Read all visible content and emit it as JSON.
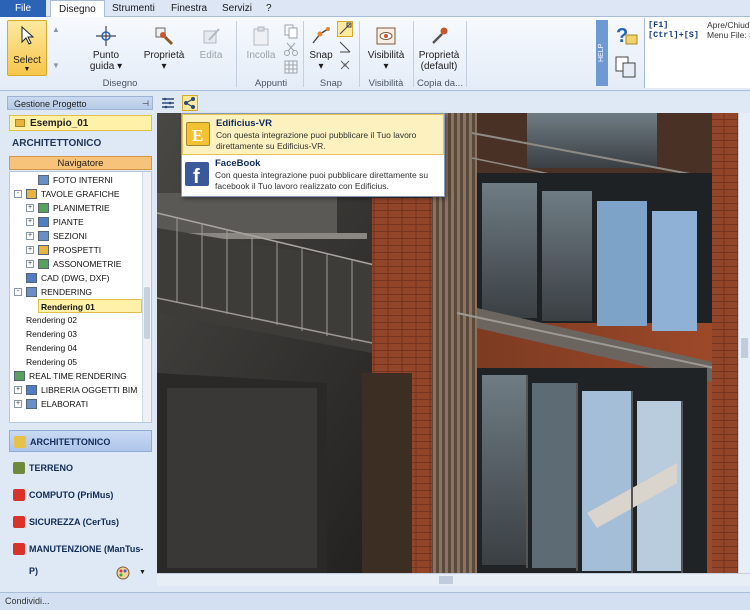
{
  "menu": {
    "file": "File",
    "tabs": [
      "Disegno",
      "Strumenti",
      "Finestra",
      "Servizi",
      "?"
    ]
  },
  "ribbon": {
    "select": "Select",
    "punto_guida": [
      "Punto",
      "guida"
    ],
    "proprieta": "Proprietà",
    "edita": "Edita",
    "incolla": "Incolla",
    "snap": "Snap",
    "visibilita": "Visibilità",
    "proprieta_default": [
      "Proprietà",
      "(default)"
    ],
    "groups": [
      "Disegno",
      "Appunti",
      "Snap",
      "Visibilità",
      "Copia da..."
    ],
    "help_tab": "HELP"
  },
  "shortcuts": [
    {
      "key": "[F1]",
      "desc": "Apre/Chiude"
    },
    {
      "key": "[Ctrl]+[S]",
      "desc": "Menu File: S"
    }
  ],
  "left": {
    "panel_title": "Gestione Progetto",
    "project": "Esempio_01",
    "section": "ARCHITETTONICO",
    "navigator": "Navigatore",
    "tree": [
      {
        "label": "FOTO INTERNI",
        "level": 2
      },
      {
        "label": "TAVOLE GRAFICHE",
        "level": 0,
        "expand": "-"
      },
      {
        "label": "PLANIMETRIE",
        "level": 1,
        "expand": "+"
      },
      {
        "label": "PIANTE",
        "level": 1,
        "expand": "+"
      },
      {
        "label": "SEZIONI",
        "level": 1,
        "expand": "+"
      },
      {
        "label": "PROSPETTI",
        "level": 1,
        "expand": "+"
      },
      {
        "label": "ASSONOMETRIE",
        "level": 1,
        "expand": "+"
      },
      {
        "label": "CAD (DWG, DXF)",
        "level": 1
      },
      {
        "label": "RENDERING",
        "level": 0,
        "expand": "-"
      },
      {
        "label": "Rendering 01",
        "level": 1,
        "selected": true
      },
      {
        "label": "Rendering 02",
        "level": 1
      },
      {
        "label": "Rendering 03",
        "level": 1
      },
      {
        "label": "Rendering 04",
        "level": 1
      },
      {
        "label": "Rendering 05",
        "level": 1
      },
      {
        "label": "REAL TIME RENDERING",
        "level": 0
      },
      {
        "label": "LIBRERIA OGGETTI BIM",
        "level": 0,
        "expand": "+"
      },
      {
        "label": "ELABORATI",
        "level": 0,
        "expand": "+"
      }
    ],
    "modules": [
      {
        "label": "ARCHITETTONICO",
        "color": "#e8c14a"
      },
      {
        "label": "TERRENO",
        "color": "#6d8a3a"
      },
      {
        "label": "COMPUTO (PriMus)",
        "color": "#d8322a"
      },
      {
        "label": "SICUREZZA (CerTus)",
        "color": "#d8322a"
      },
      {
        "label": "MANUTENZIONE (ManTus-P)",
        "color": "#d8322a"
      }
    ]
  },
  "popup": [
    {
      "title": "Edificius-VR",
      "desc": "Con questa integrazione puoi pubblicare il Tuo lavoro direttamente su Edificius-VR.",
      "icon_color": "#f2c233"
    },
    {
      "title": "FaceBook",
      "desc": "Con questa integrazione puoi pubblicare direttamente su facebook il Tuo lavoro realizzato con Edificius.",
      "icon_color": "#3b5998"
    }
  ],
  "status": "Condividi..."
}
